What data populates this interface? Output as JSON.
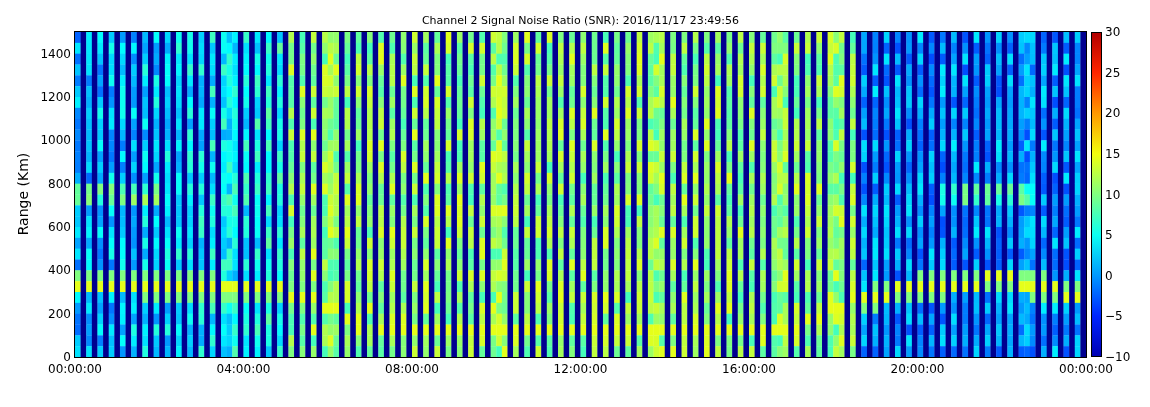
{
  "title": "Channel 2 Signal Noise Ratio (SNR): 2016/11/17 23:49:56",
  "y_axis": {
    "label": "Range (Km)",
    "ticks": [
      "1400",
      "1200",
      "1000",
      "800",
      "600",
      "400",
      "200",
      "0"
    ]
  },
  "x_axis": {
    "ticks": [
      "00:00:00",
      "04:00:00",
      "08:00:00",
      "12:00:00",
      "16:00:00",
      "20:00:00",
      "00:00:00"
    ]
  },
  "colorbar": {
    "ticks": [
      "30",
      "25",
      "20",
      "15",
      "10",
      "5",
      "0",
      "−5",
      "−10"
    ]
  }
}
